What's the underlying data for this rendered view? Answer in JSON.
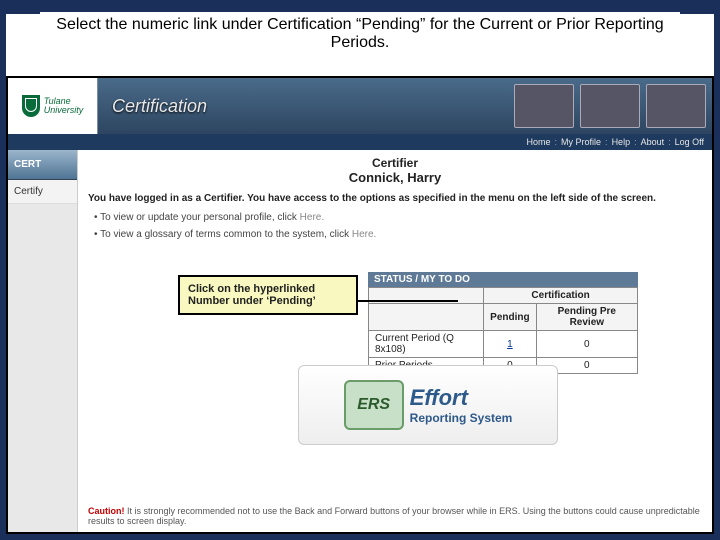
{
  "slide": {
    "title": "Select the numeric link under Certification “Pending” for the Current or Prior Reporting Periods."
  },
  "logo": {
    "line1": "Tulane",
    "line2": "University"
  },
  "banner": {
    "label": "Certification"
  },
  "topnav": {
    "home": "Home",
    "profile": "My Profile",
    "help": "Help",
    "about": "About",
    "logoff": "Log Off"
  },
  "sidebar": {
    "header": "CERT",
    "certify": "Certify"
  },
  "certifier": {
    "role": "Certifier",
    "name": "Connick, Harry"
  },
  "intro": "You have logged in as a Certifier. You have access to the options as specified in the menu on the left side of the screen.",
  "bullets": {
    "b1a": "To view or update your personal profile, click ",
    "b1b": "Here.",
    "b2a": "To view a glossary of terms common to the system, click ",
    "b2b": "Here."
  },
  "callout": "Click on the hyperlinked Number under ‘Pending’",
  "status": {
    "title": "STATUS / MY TO DO",
    "group": "Certification",
    "cols": {
      "pending": "Pending",
      "prereview": "Pending Pre Review"
    },
    "rows": [
      {
        "label": "Current Period (Q 8x108)",
        "pending": "1",
        "prereview": "0",
        "link": true
      },
      {
        "label": "Prior Periods",
        "pending": "0",
        "prereview": "0",
        "link": false
      }
    ]
  },
  "ers": {
    "badge": "ERS",
    "line1": "Effort",
    "line2": "Reporting System"
  },
  "caution": {
    "label": "Caution!",
    "text": " It is strongly recommended not to use the Back and Forward buttons of your browser while in ERS. Using the buttons could cause unpredictable results to screen display."
  }
}
